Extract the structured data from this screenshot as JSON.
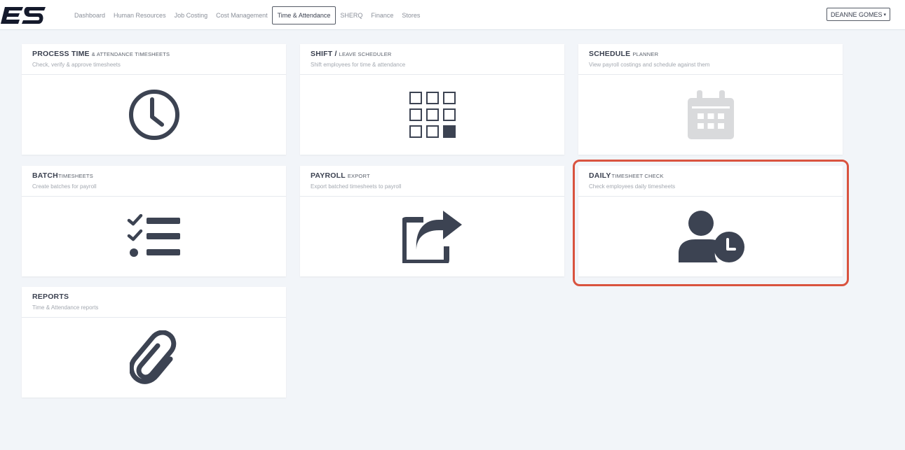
{
  "logo_text": "ES",
  "nav": {
    "items": [
      {
        "label": "Dashboard"
      },
      {
        "label": "Human Resources"
      },
      {
        "label": "Job Costing"
      },
      {
        "label": "Cost Management"
      },
      {
        "label": "Time & Attendance",
        "active": true
      },
      {
        "label": "SHERQ"
      },
      {
        "label": "Finance"
      },
      {
        "label": "Stores"
      }
    ]
  },
  "user": {
    "name": "DEANNE GOMES",
    "caret": "▾"
  },
  "cards": {
    "process_time": {
      "title": "PROCESS TIME",
      "subtitle": "& ATTENDANCE TIMESHEETS",
      "description": "Check, verify & approve timesheets",
      "icon": "clock-icon"
    },
    "shift": {
      "title": "SHIFT /",
      "subtitle": "LEAVE SCHEDULER",
      "description": "Shift employees for time & attendance",
      "icon": "grid-icon"
    },
    "schedule": {
      "title": "SCHEDULE",
      "subtitle": "PLANNER",
      "description": "View payroll costings and schedule against them",
      "icon": "calendar-icon"
    },
    "batch": {
      "title": "BATCH",
      "subtitle": "TIMESHEETS",
      "description": "Create batches for payroll",
      "icon": "checklist-icon"
    },
    "payroll": {
      "title": "PAYROLL",
      "subtitle": "EXPORT",
      "description": "Export batched timesheets to payroll",
      "icon": "share-export-icon"
    },
    "daily": {
      "title": "DAILY",
      "subtitle": "TIMESHEET CHECK",
      "description": "Check employees daily timesheets",
      "icon": "user-clock-icon"
    },
    "reports": {
      "title": "REPORTS",
      "subtitle": "",
      "description": "Time & Attendance reports",
      "icon": "paperclip-icon"
    }
  },
  "colors": {
    "icon": "#3c4352",
    "icon_muted": "#d9dadc",
    "highlight": "#d9533f",
    "background": "#f2f5f9"
  }
}
